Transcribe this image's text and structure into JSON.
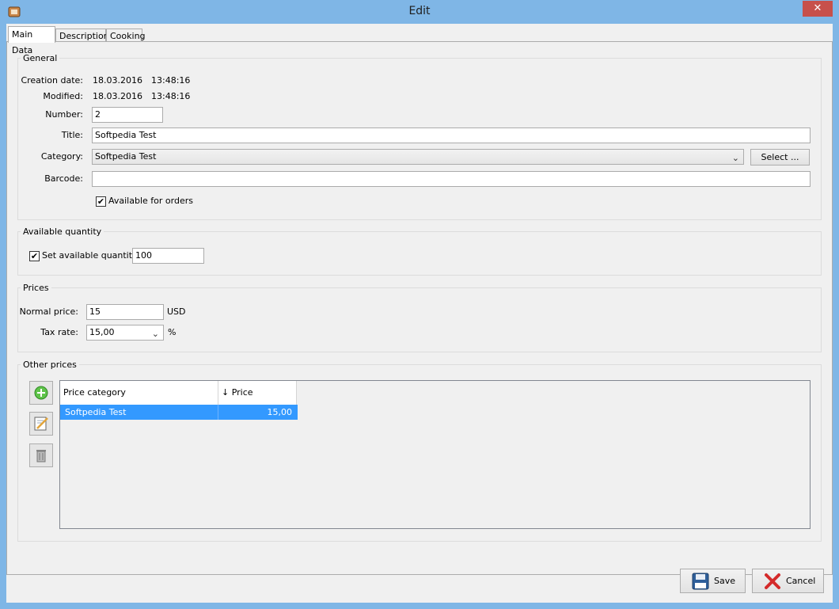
{
  "window": {
    "title": "Edit",
    "close_glyph": "✕",
    "app_icon": "app-icon"
  },
  "tabs": [
    {
      "label": "Main Data",
      "active": true
    },
    {
      "label": "Description",
      "active": false
    },
    {
      "label": "Cooking",
      "active": false
    }
  ],
  "general": {
    "title": "General",
    "creation_label": "Creation date:",
    "creation_date": "18.03.2016",
    "creation_time": "13:48:16",
    "modified_label": "Modified:",
    "modified_date": "18.03.2016",
    "modified_time": "13:48:16",
    "number_label": "Number:",
    "number_value": "2",
    "title_label": "Title:",
    "title_value": "Softpedia Test",
    "category_label": "Category:",
    "category_value": "Softpedia Test",
    "select_button": "Select ...",
    "barcode_label": "Barcode:",
    "barcode_value": "",
    "available_orders_label": "Available for orders",
    "available_orders_checked": true
  },
  "quantity": {
    "title": "Available quantity",
    "set_label": "Set available quantity:",
    "set_checked": true,
    "value": "100"
  },
  "prices": {
    "title": "Prices",
    "normal_label": "Normal price:",
    "normal_value": "15",
    "currency": "USD",
    "tax_label": "Tax rate:",
    "tax_value": "15,00",
    "tax_unit": "%"
  },
  "other_prices": {
    "title": "Other prices",
    "columns": [
      "Price category",
      "↓ Price"
    ],
    "rows": [
      {
        "category": "Softpedia Test",
        "price": "15,00"
      }
    ],
    "buttons": {
      "add": "add-icon",
      "edit": "edit-icon",
      "delete": "trash-icon"
    }
  },
  "footer": {
    "save": "Save",
    "cancel": "Cancel"
  },
  "check_glyph": "✔"
}
